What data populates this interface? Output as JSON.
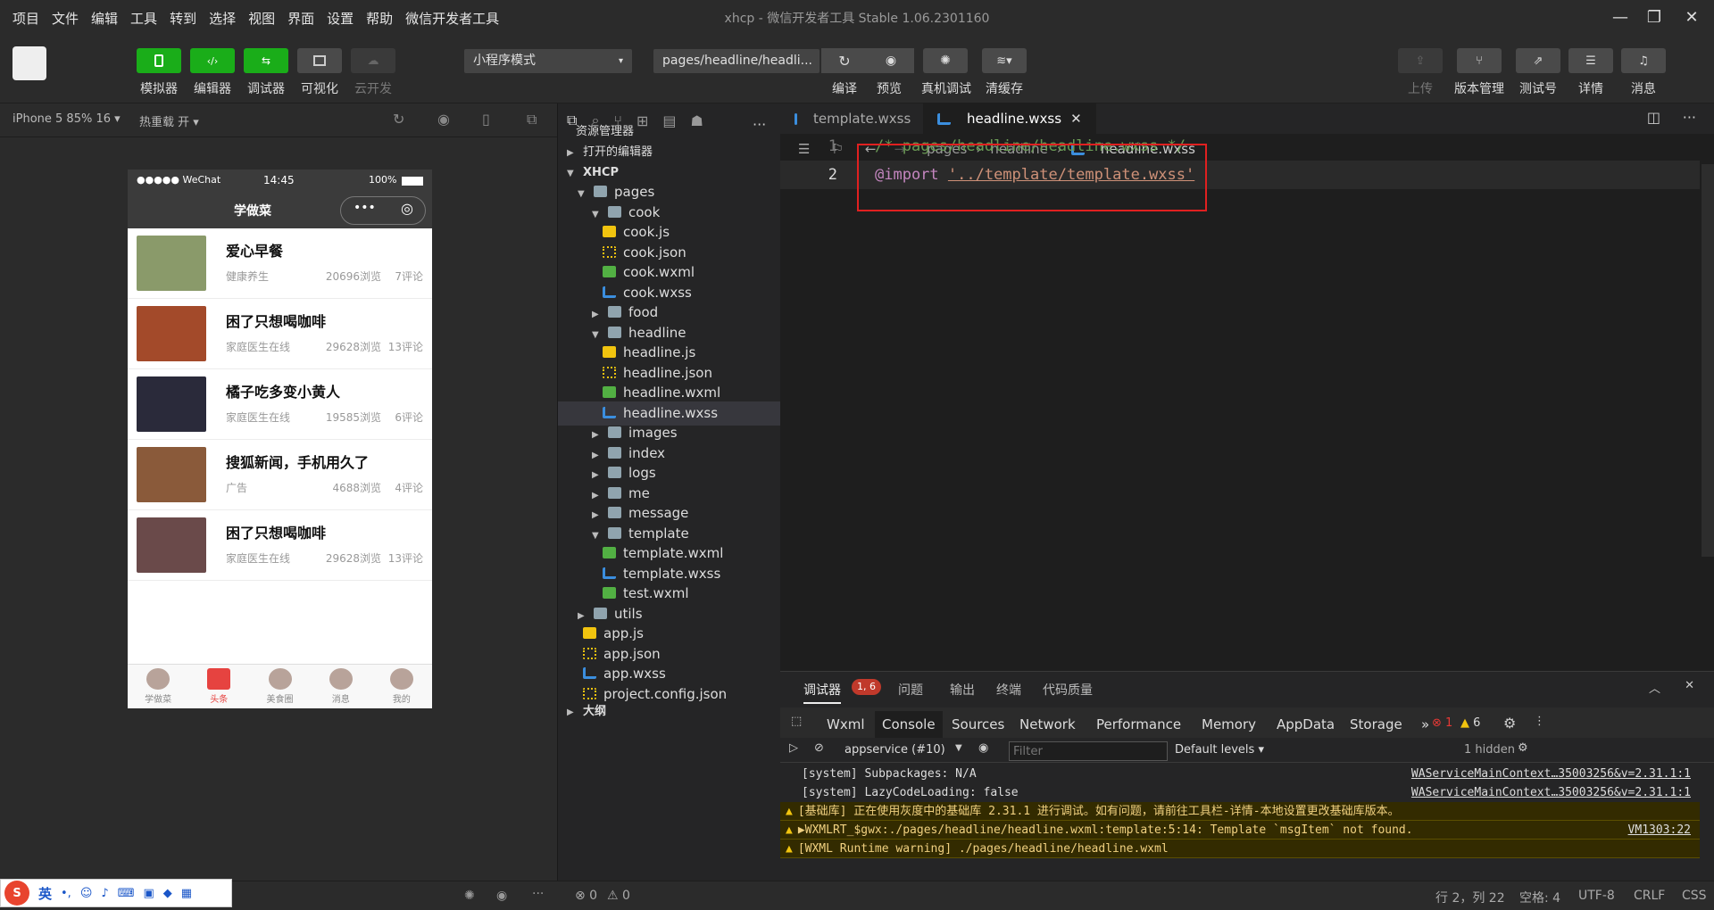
{
  "menu": [
    "项目",
    "文件",
    "编辑",
    "工具",
    "转到",
    "选择",
    "视图",
    "界面",
    "设置",
    "帮助",
    "微信开发者工具"
  ],
  "window_title": "xhcp - 微信开发者工具 Stable 1.06.2301160",
  "toolbar": {
    "simulator": "模拟器",
    "editor": "编辑器",
    "debugger": "调试器",
    "visual": "可视化",
    "cloud": "云开发",
    "mode_select": "小程序模式",
    "path_select": "pages/headline/headli...",
    "compile": "编译",
    "preview": "预览",
    "real_debug": "真机调试",
    "clear_cache": "清缓存",
    "upload": "上传",
    "version": "版本管理",
    "test_account": "测试号",
    "details": "详情",
    "messages": "消息"
  },
  "sim": {
    "device": "iPhone 5 85% 16 ▾",
    "hot_reload": "热重载 开 ▾",
    "status_left": "●●●●● WeChat",
    "status_time": "14:45",
    "status_battery": "100%",
    "nav_title": "学做菜",
    "items": [
      {
        "title": "爱心早餐",
        "source": "健康养生",
        "views": "20696浏览",
        "comments": "7评论",
        "color": "#8a9a6a"
      },
      {
        "title": "困了只想喝咖啡",
        "source": "家庭医生在线",
        "views": "29628浏览",
        "comments": "13评论",
        "color": "#a34a2a"
      },
      {
        "title": "橘子吃多变小黄人",
        "source": "家庭医生在线",
        "views": "19585浏览",
        "comments": "6评论",
        "color": "#2a2a3a"
      },
      {
        "title": "搜狐新闻，手机用久了",
        "source": "广告",
        "views": "4688浏览",
        "comments": "4评论",
        "color": "#8a5a3a"
      },
      {
        "title": "困了只想喝咖啡",
        "source": "家庭医生在线",
        "views": "29628浏览",
        "comments": "13评论",
        "color": "#6a4a4a"
      }
    ],
    "tabs": [
      "学做菜",
      "头条",
      "美食圈",
      "消息",
      "我的"
    ]
  },
  "explorer": {
    "title": "资源管理器",
    "open_editors": "打开的编辑器",
    "project": "XHCP",
    "outline": "大纲",
    "tree": [
      {
        "label": "pages",
        "type": "folder",
        "depth": 1,
        "arrow": "▼"
      },
      {
        "label": "cook",
        "type": "folder",
        "depth": 2,
        "arrow": "▼"
      },
      {
        "label": "cook.js",
        "type": "js",
        "depth": 3
      },
      {
        "label": "cook.json",
        "type": "json",
        "depth": 3
      },
      {
        "label": "cook.wxml",
        "type": "wxml",
        "depth": 3
      },
      {
        "label": "cook.wxss",
        "type": "wxss",
        "depth": 3
      },
      {
        "label": "food",
        "type": "folder",
        "depth": 2,
        "arrow": "▶"
      },
      {
        "label": "headline",
        "type": "folder",
        "depth": 2,
        "arrow": "▼"
      },
      {
        "label": "headline.js",
        "type": "js",
        "depth": 3
      },
      {
        "label": "headline.json",
        "type": "json",
        "depth": 3
      },
      {
        "label": "headline.wxml",
        "type": "wxml",
        "depth": 3
      },
      {
        "label": "headline.wxss",
        "type": "wxss",
        "depth": 3,
        "selected": true
      },
      {
        "label": "images",
        "type": "folder",
        "depth": 2,
        "arrow": "▶"
      },
      {
        "label": "index",
        "type": "folder",
        "depth": 2,
        "arrow": "▶"
      },
      {
        "label": "logs",
        "type": "folder",
        "depth": 2,
        "arrow": "▶"
      },
      {
        "label": "me",
        "type": "folder",
        "depth": 2,
        "arrow": "▶"
      },
      {
        "label": "message",
        "type": "folder",
        "depth": 2,
        "arrow": "▶"
      },
      {
        "label": "template",
        "type": "folder",
        "depth": 2,
        "arrow": "▼"
      },
      {
        "label": "template.wxml",
        "type": "wxml",
        "depth": 3
      },
      {
        "label": "template.wxss",
        "type": "wxss",
        "depth": 3
      },
      {
        "label": "test.wxml",
        "type": "wxml",
        "depth": 3
      },
      {
        "label": "utils",
        "type": "folder",
        "depth": 1,
        "arrow": "▶"
      },
      {
        "label": "app.js",
        "type": "js",
        "depth": 1
      },
      {
        "label": "app.json",
        "type": "json",
        "depth": 1
      },
      {
        "label": "app.wxss",
        "type": "wxss",
        "depth": 1
      },
      {
        "label": "project.config.json",
        "type": "json",
        "depth": 1
      }
    ]
  },
  "editor": {
    "tabs": [
      "template.wxss",
      "headline.wxss"
    ],
    "breadcrumb": [
      "pages",
      "headline",
      "headline.wxss"
    ],
    "lines": [
      {
        "n": "1",
        "text": "/* pages/headline/headline.wxss */"
      },
      {
        "n": "2",
        "kw": "@import ",
        "str": "'../template/template.wxss'"
      }
    ]
  },
  "devtools": {
    "tabs": [
      "调试器",
      "问题",
      "输出",
      "终端",
      "代码质量"
    ],
    "badge": "1, 6",
    "console_tabs": [
      "Wxml",
      "Console",
      "Sources",
      "Network",
      "Performance",
      "Memory",
      "AppData",
      "Storage"
    ],
    "errors": "1",
    "warnings": "6",
    "context": "appservice (#10)",
    "filter_placeholder": "Filter",
    "levels": "Default levels ▾",
    "hidden": "1 hidden",
    "logs": [
      {
        "text": "[system] Subpackages: N/A",
        "src": "WAServiceMainContext…35003256&v=2.31.1:1",
        "warn": false
      },
      {
        "text": "[system] LazyCodeLoading: false",
        "src": "WAServiceMainContext…35003256&v=2.31.1:1",
        "warn": false
      },
      {
        "text": "[基础库] 正在使用灰度中的基础库 2.31.1 进行调试。如有问题，请前往工具栏-详情-本地设置更改基础库版本。",
        "src": "",
        "warn": true
      },
      {
        "text": "▶WXMLRT_$gwx:./pages/headline/headline.wxml:template:5:14: Template `msgItem` not found.",
        "src": "VM1303:22",
        "warn": true
      },
      {
        "text": "[WXML Runtime warning] ./pages/headline/headline.wxml",
        "src": "",
        "warn": true
      }
    ]
  },
  "status": {
    "errors": "⊗ 0",
    "warnings": "⚠ 0",
    "pos": "行 2，列 22",
    "spaces": "空格: 4",
    "encoding": "UTF-8",
    "eol": "CRLF",
    "lang": "CSS"
  },
  "ime": {
    "label": "英"
  }
}
